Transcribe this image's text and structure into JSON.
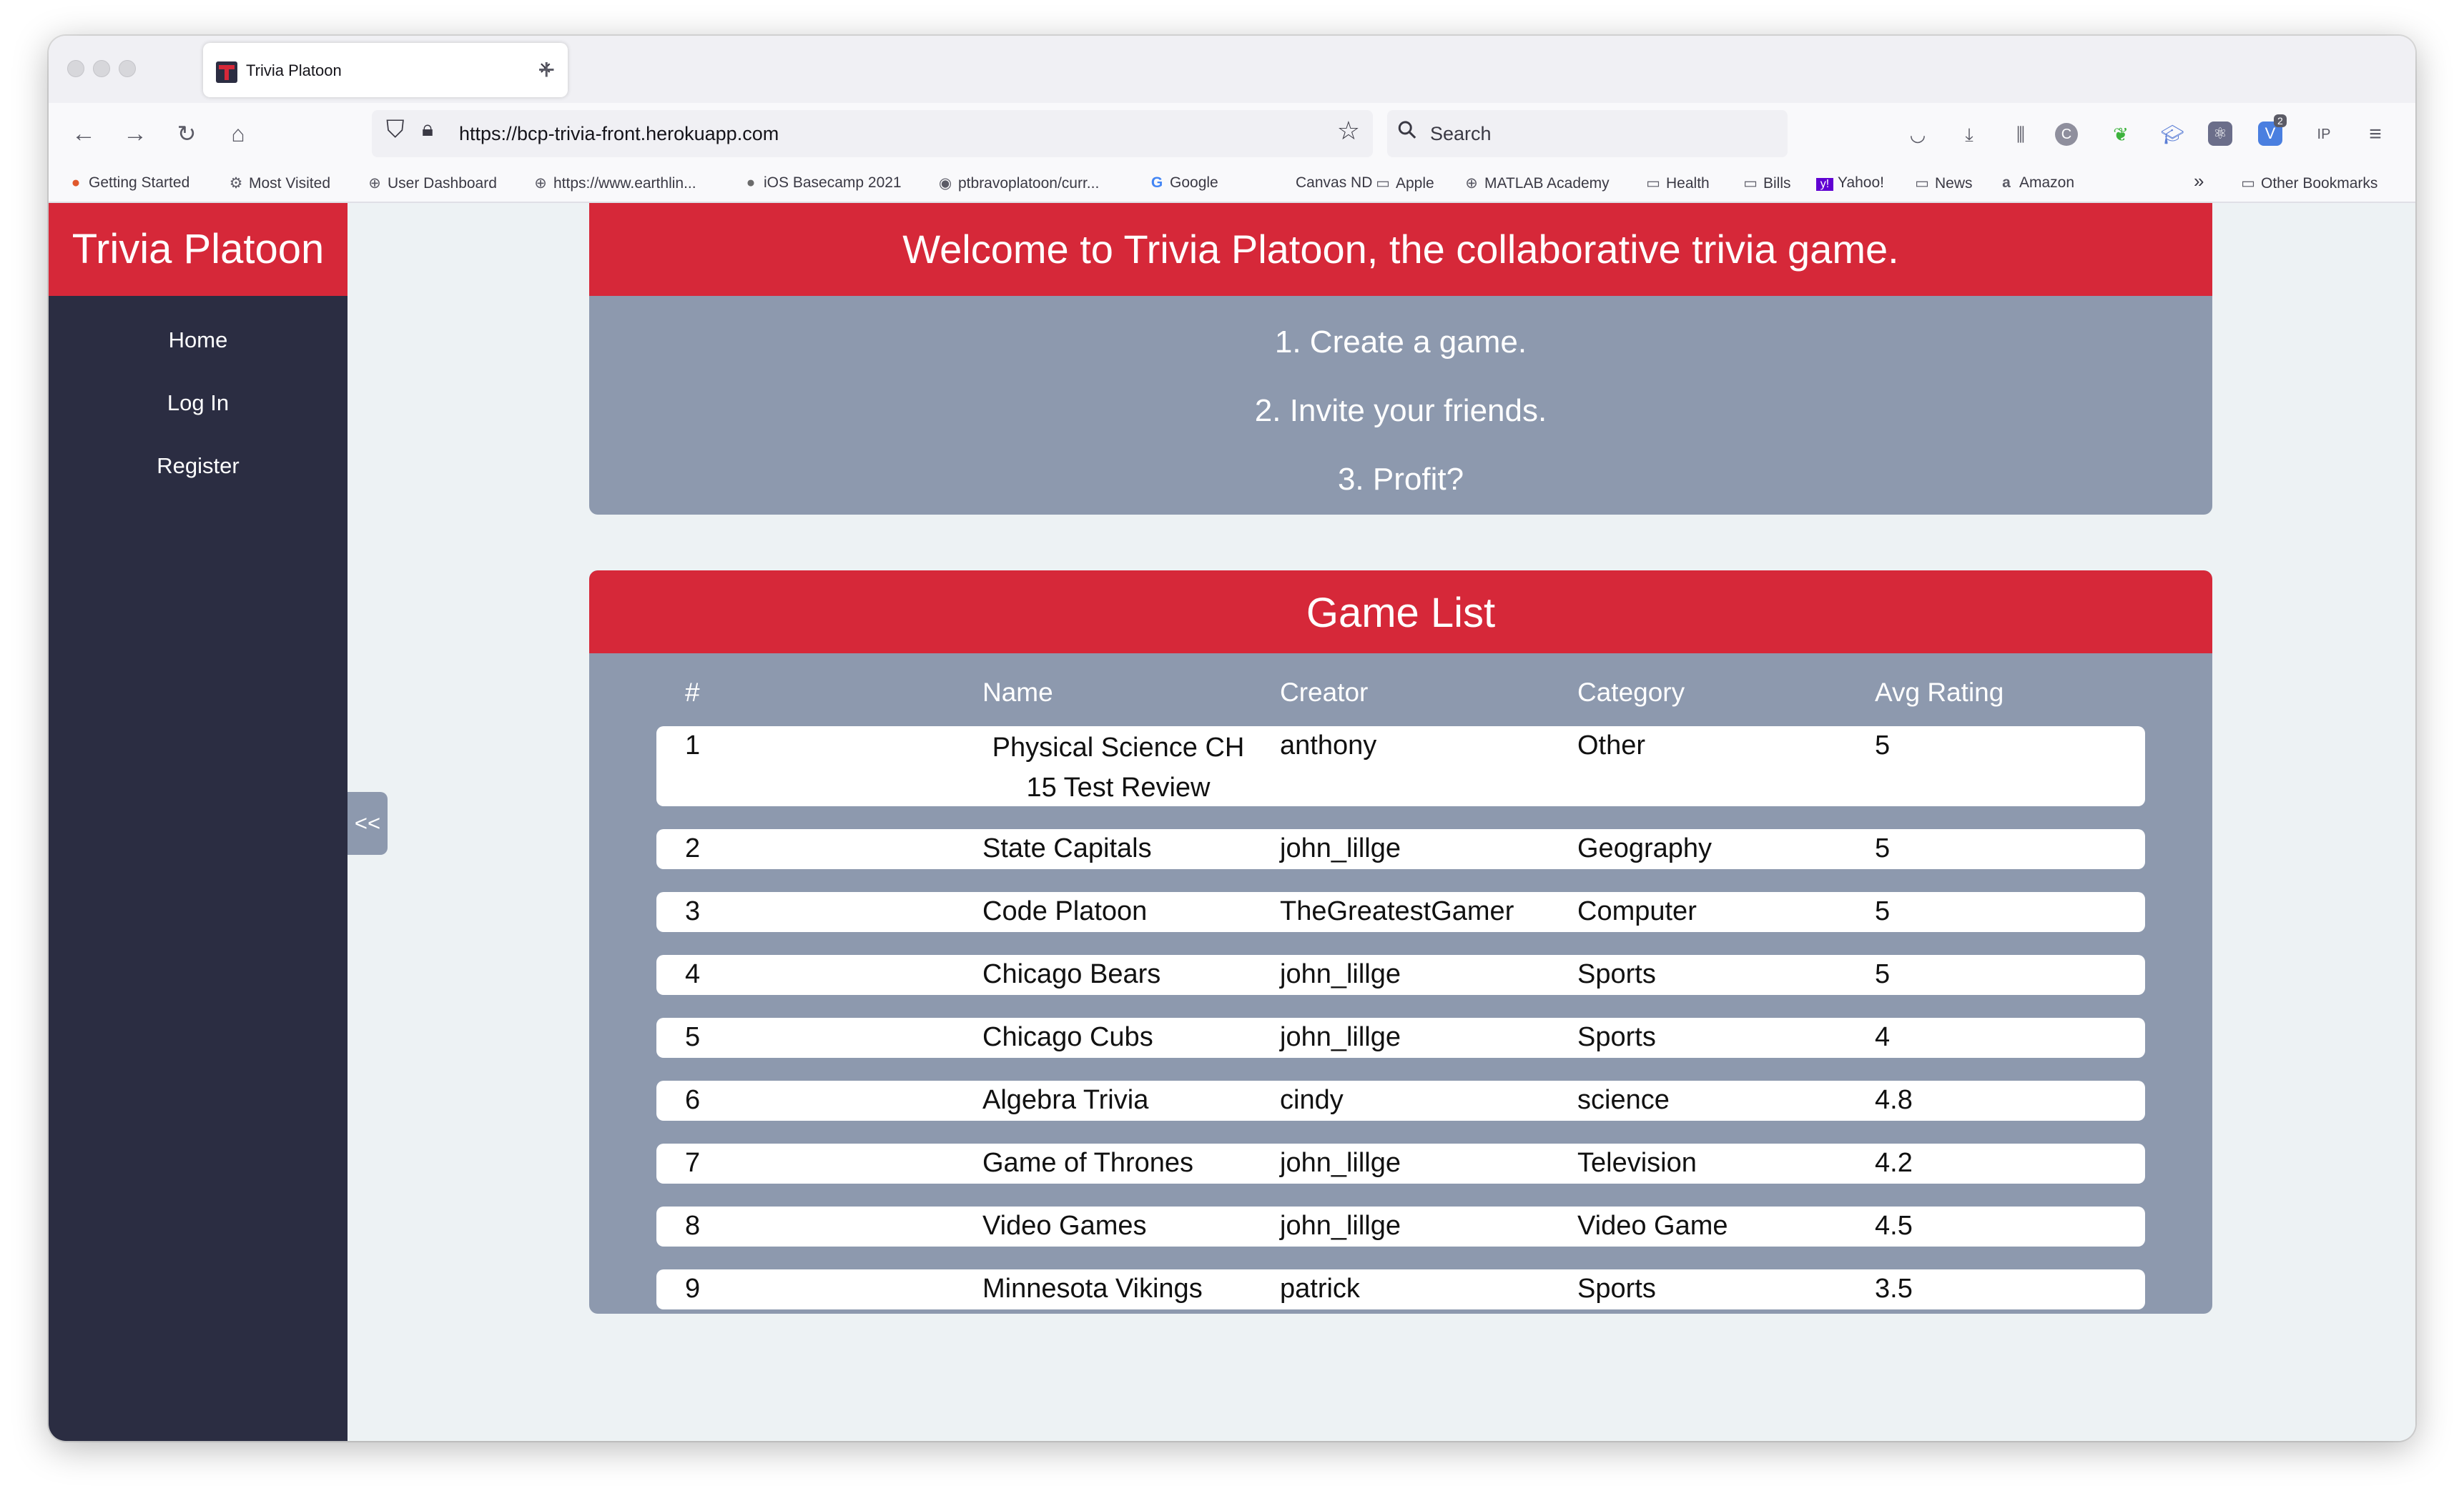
{
  "browser": {
    "tab_title": "Trivia Platoon",
    "url": "https://bcp-trivia-front.herokuapp.com",
    "search_placeholder": "Search",
    "bookmarks": [
      "Getting Started",
      "Most Visited",
      "User Dashboard",
      "https://www.earthlin...",
      "iOS Basecamp 2021",
      "ptbravoplatoon/curr...",
      "Google",
      "Canvas ND",
      "Apple",
      "MATLAB Academy",
      "Health",
      "Bills",
      "Yahoo!",
      "News",
      "Amazon"
    ],
    "other_bookmarks": "Other Bookmarks",
    "extension_badge": "2"
  },
  "sidebar": {
    "brand": "Trivia Platoon",
    "links": [
      "Home",
      "Log In",
      "Register"
    ],
    "collapse_label": "<<"
  },
  "welcome": {
    "title": "Welcome to Trivia Platoon, the collaborative trivia game.",
    "steps": [
      "1. Create a game.",
      "2. Invite your friends.",
      "3. Profit?"
    ]
  },
  "game_list": {
    "title": "Game List",
    "columns": [
      "#",
      "Name",
      "Creator",
      "Category",
      "Avg Rating"
    ],
    "rows": [
      {
        "num": "1",
        "name": "Physical Science CH 15 Test Review",
        "creator": "anthony",
        "category": "Other",
        "rating": "5"
      },
      {
        "num": "2",
        "name": "State Capitals",
        "creator": "john_lillge",
        "category": "Geography",
        "rating": "5"
      },
      {
        "num": "3",
        "name": "Code Platoon",
        "creator": "TheGreatestGamer",
        "category": "Computer",
        "rating": "5"
      },
      {
        "num": "4",
        "name": "Chicago Bears",
        "creator": "john_lillge",
        "category": "Sports",
        "rating": "5"
      },
      {
        "num": "5",
        "name": "Chicago Cubs",
        "creator": "john_lillge",
        "category": "Sports",
        "rating": "4"
      },
      {
        "num": "6",
        "name": "Algebra Trivia",
        "creator": "cindy",
        "category": "science",
        "rating": "4.8"
      },
      {
        "num": "7",
        "name": "Game of Thrones",
        "creator": "john_lillge",
        "category": "Television",
        "rating": "4.2"
      },
      {
        "num": "8",
        "name": "Video Games",
        "creator": "john_lillge",
        "category": "Video Game",
        "rating": "4.5"
      },
      {
        "num": "9",
        "name": "Minnesota Vikings",
        "creator": "patrick",
        "category": "Sports",
        "rating": "3.5"
      }
    ]
  },
  "colors": {
    "accent_red": "#d62839",
    "sidebar_navy": "#2b2d42",
    "card_gray": "#8d99ae",
    "page_bg": "#edf2f4"
  }
}
